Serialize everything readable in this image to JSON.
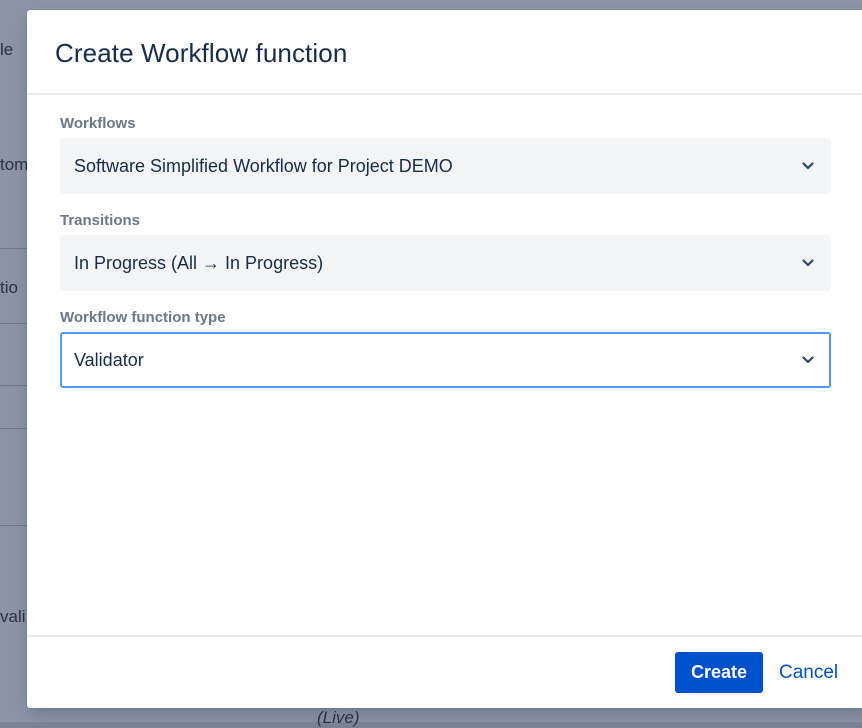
{
  "background": {
    "fragments": [
      "le",
      "tom",
      "tio",
      "vali",
      "(Live)"
    ]
  },
  "dialog": {
    "title": "Create Workflow function",
    "fields": [
      {
        "label": "Workflows",
        "value": "Software Simplified Workflow for Project DEMO"
      },
      {
        "label": "Transitions",
        "value": "In Progress (All → In Progress)"
      },
      {
        "label": "Workflow function type",
        "value": "Validator"
      }
    ],
    "buttons": {
      "create": "Create",
      "cancel": "Cancel"
    }
  },
  "colors": {
    "primary": "#0052cc",
    "focus_border": "#4c9aff",
    "select_bg": "#f4f5f7",
    "label": "#6b778c",
    "text": "#172b4d"
  }
}
